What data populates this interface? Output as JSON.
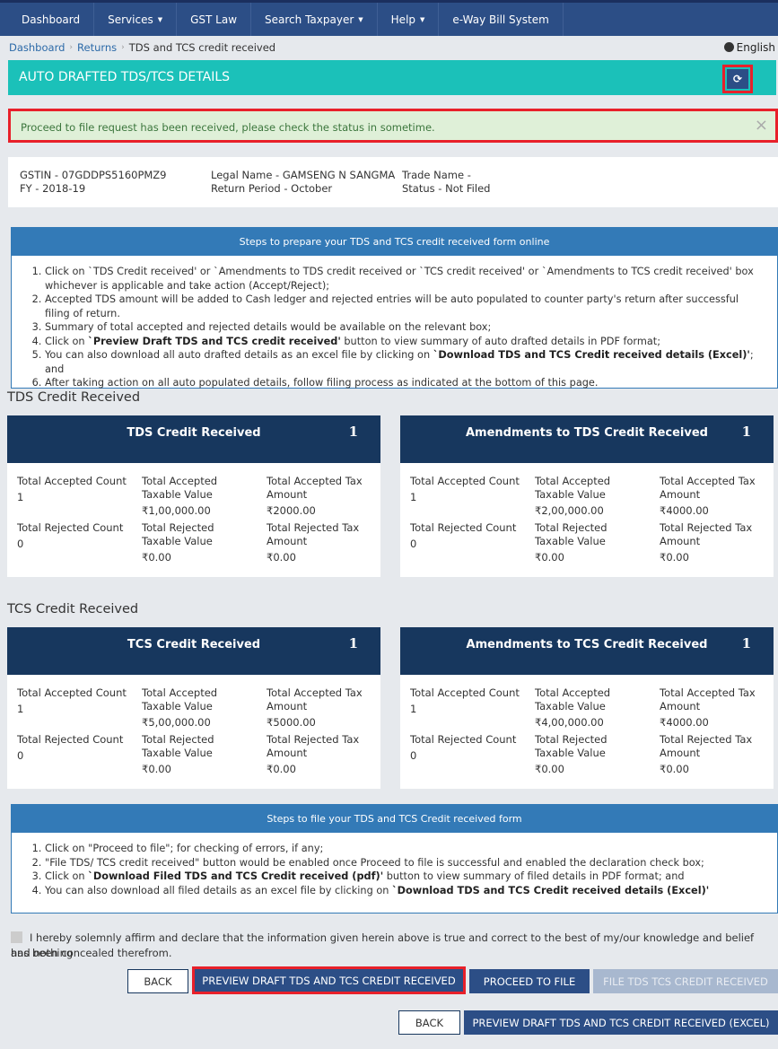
{
  "nav": {
    "items": [
      {
        "label": "Dashboard",
        "caret": false
      },
      {
        "label": "Services",
        "caret": true
      },
      {
        "label": "GST Law",
        "caret": false
      },
      {
        "label": "Search Taxpayer",
        "caret": true
      },
      {
        "label": "Help",
        "caret": true
      },
      {
        "label": "e-Way Bill System",
        "caret": false
      }
    ],
    "caret_glyph": "▼"
  },
  "breadcrumb": {
    "items": [
      "Dashboard",
      "Returns"
    ],
    "current": "TDS and TCS credit received",
    "separator": "›"
  },
  "language": "English",
  "page_title": "AUTO DRAFTED TDS/TCS DETAILS",
  "refresh_icon": "⟳",
  "alert": {
    "message": "Proceed to file request has been received, please check the status in sometime.",
    "close_glyph": "×"
  },
  "info": {
    "gstin": "GSTIN - 07GDDPS5160PMZ9",
    "fy": "FY - 2018-19",
    "legal_name": "Legal Name - GAMSENG N SANGMA",
    "return_period": "Return Period - October",
    "trade_name": "Trade Name -",
    "status": "Status - Not Filed"
  },
  "prepare_steps": {
    "title": "Steps to prepare your TDS and TCS credit received form online",
    "items": [
      {
        "pre": "Click on `TDS Credit received' or `Amendments to TDS credit received or `TCS credit received' or `Amendments to TCS credit received' box whichever is applicable and take action (Accept/Reject);",
        "bold": "",
        "post": ""
      },
      {
        "pre": "Accepted TDS amount will be added to Cash ledger and rejected entries will be auto populated to counter party's return after successful filing of return.",
        "bold": "",
        "post": ""
      },
      {
        "pre": "Summary of total accepted and rejected details would be available on the relevant box;",
        "bold": "",
        "post": ""
      },
      {
        "pre": "Click on ",
        "bold": "`Preview Draft TDS and TCS credit received'",
        "post": " button to view summary of auto drafted details in PDF format;"
      },
      {
        "pre": "You can also download all auto drafted details as an excel file by clicking on ",
        "bold": "`Download TDS and TCS Credit received details (Excel)'",
        "post": "; and"
      },
      {
        "pre": "After taking action on all auto populated details, follow filing process as indicated at the bottom of this page.",
        "bold": "",
        "post": ""
      }
    ]
  },
  "sections": {
    "tds_title": "TDS Credit Received",
    "tcs_title": "TCS Credit Received"
  },
  "labels": {
    "accepted_count": "Total Accepted Count",
    "accepted_taxable_l1": "Total Accepted",
    "accepted_taxable_l2": "Taxable Value",
    "accepted_tax_l1": "Total Accepted Tax",
    "accepted_tax_l2": "Amount",
    "rejected_count": "Total Rejected Count",
    "rejected_taxable_l1": "Total Rejected",
    "rejected_taxable_l2": "Taxable Value",
    "rejected_tax_l1": "Total Rejected Tax",
    "rejected_tax_l2": "Amount"
  },
  "cards": [
    {
      "title": "TDS Credit Received",
      "count": "1",
      "accepted_count": "1",
      "accepted_taxable": "₹1,00,000.00",
      "accepted_tax": "₹2000.00",
      "rejected_count": "0",
      "rejected_taxable": "₹0.00",
      "rejected_tax": "₹0.00"
    },
    {
      "title": "Amendments to TDS Credit Received",
      "count": "1",
      "accepted_count": "1",
      "accepted_taxable": "₹2,00,000.00",
      "accepted_tax": "₹4000.00",
      "rejected_count": "0",
      "rejected_taxable": "₹0.00",
      "rejected_tax": "₹0.00"
    },
    {
      "title": "TCS Credit Received",
      "count": "1",
      "accepted_count": "1",
      "accepted_taxable": "₹5,00,000.00",
      "accepted_tax": "₹5000.00",
      "rejected_count": "0",
      "rejected_taxable": "₹0.00",
      "rejected_tax": "₹0.00"
    },
    {
      "title": "Amendments to TCS Credit Received",
      "count": "1",
      "accepted_count": "1",
      "accepted_taxable": "₹4,00,000.00",
      "accepted_tax": "₹4000.00",
      "rejected_count": "0",
      "rejected_taxable": "₹0.00",
      "rejected_tax": "₹0.00"
    }
  ],
  "file_steps": {
    "title": "Steps to file your TDS and TCS Credit received form",
    "items": [
      {
        "pre": "Click on \"Proceed to file\"; for checking of errors, if any;",
        "bold": "",
        "post": ""
      },
      {
        "pre": "\"File TDS/ TCS credit received\" button would be enabled once Proceed to file is successful and enabled the declaration check box;",
        "bold": "",
        "post": ""
      },
      {
        "pre": "Click on ",
        "bold": "`Download Filed TDS and TCS Credit received (pdf)'",
        "post": " button to view summary of filed details in PDF format; and"
      },
      {
        "pre": "You can also download all filed details as an excel file by clicking on ",
        "bold": "`Download TDS and TCS Credit received details (Excel)'",
        "post": ""
      }
    ]
  },
  "declaration": {
    "line1": "I hereby solemnly affirm and declare that the information given herein above is true and correct to the best of my/our knowledge and belief and nothing",
    "line2": "has been concealed therefrom.",
    "checked": false
  },
  "buttons": {
    "back": "BACK",
    "preview_draft": "PREVIEW DRAFT TDS AND TCS CREDIT RECEIVED",
    "proceed_to_file": "PROCEED TO FILE",
    "file": "FILE TDS TCS CREDIT RECEIVED",
    "back2": "BACK",
    "preview_excel": "PREVIEW DRAFT TDS AND TCS CREDIT RECEIVED (EXCEL)"
  }
}
